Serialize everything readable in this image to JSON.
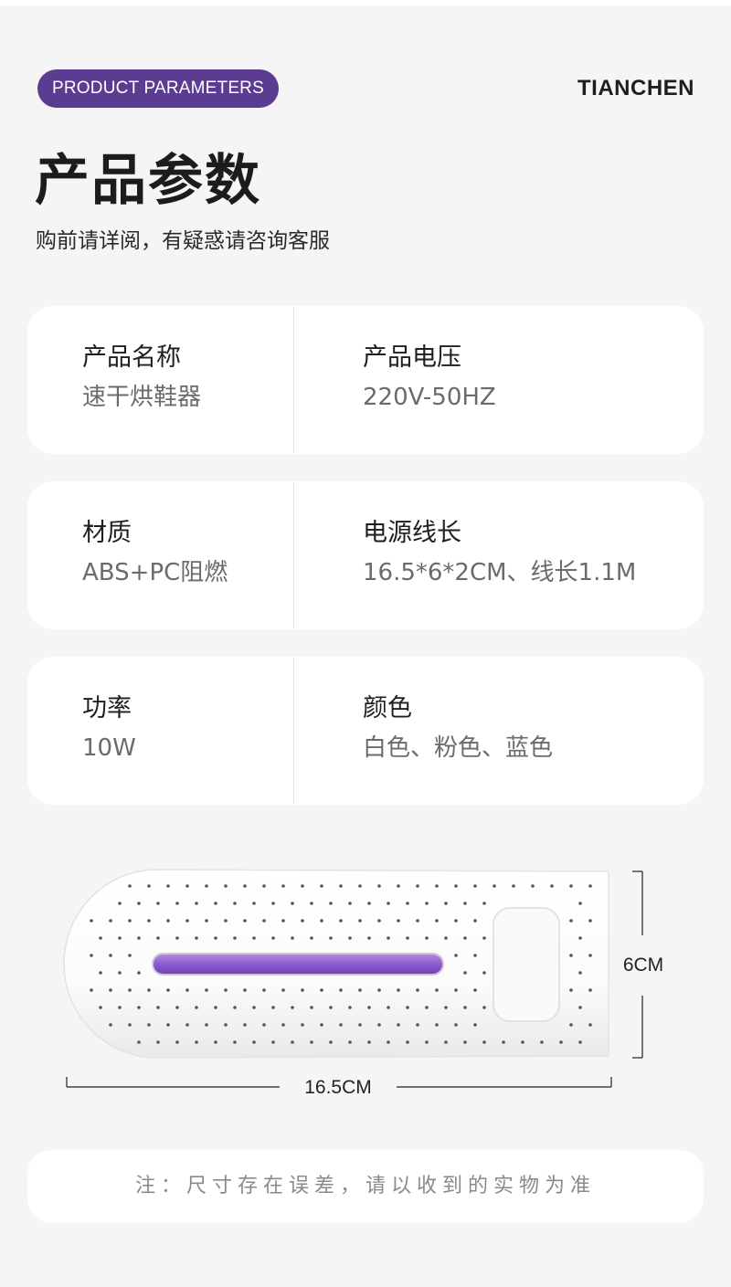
{
  "header": {
    "badge_label": "PRODUCT PARAMETERS",
    "brand": "TIANCHEN",
    "title": "产品参数",
    "subtitle": "购前请详阅，有疑惑请咨询客服"
  },
  "params": [
    {
      "left": {
        "label": "产品名称",
        "value": "速干烘鞋器"
      },
      "right": {
        "label": "产品电压",
        "value": "220V-50HZ"
      }
    },
    {
      "left": {
        "label": "材质",
        "value": "ABS+PC阻燃"
      },
      "right": {
        "label": "电源线长",
        "value": "16.5*6*2CM、线长1.1M"
      }
    },
    {
      "left": {
        "label": "功率",
        "value": "10W"
      },
      "right": {
        "label": "颜色",
        "value": "白色、粉色、蓝色"
      }
    }
  ],
  "product_image": {
    "height_label": "6CM",
    "width_label": "16.5CM",
    "light_color": "#8e5bd1"
  },
  "note": "注：尺寸存在误差，请以收到的实物为准",
  "colors": {
    "badge": "#5a3d91",
    "background": "#f5f5f5",
    "card": "#ffffff",
    "value_text": "#6b6b6b"
  }
}
